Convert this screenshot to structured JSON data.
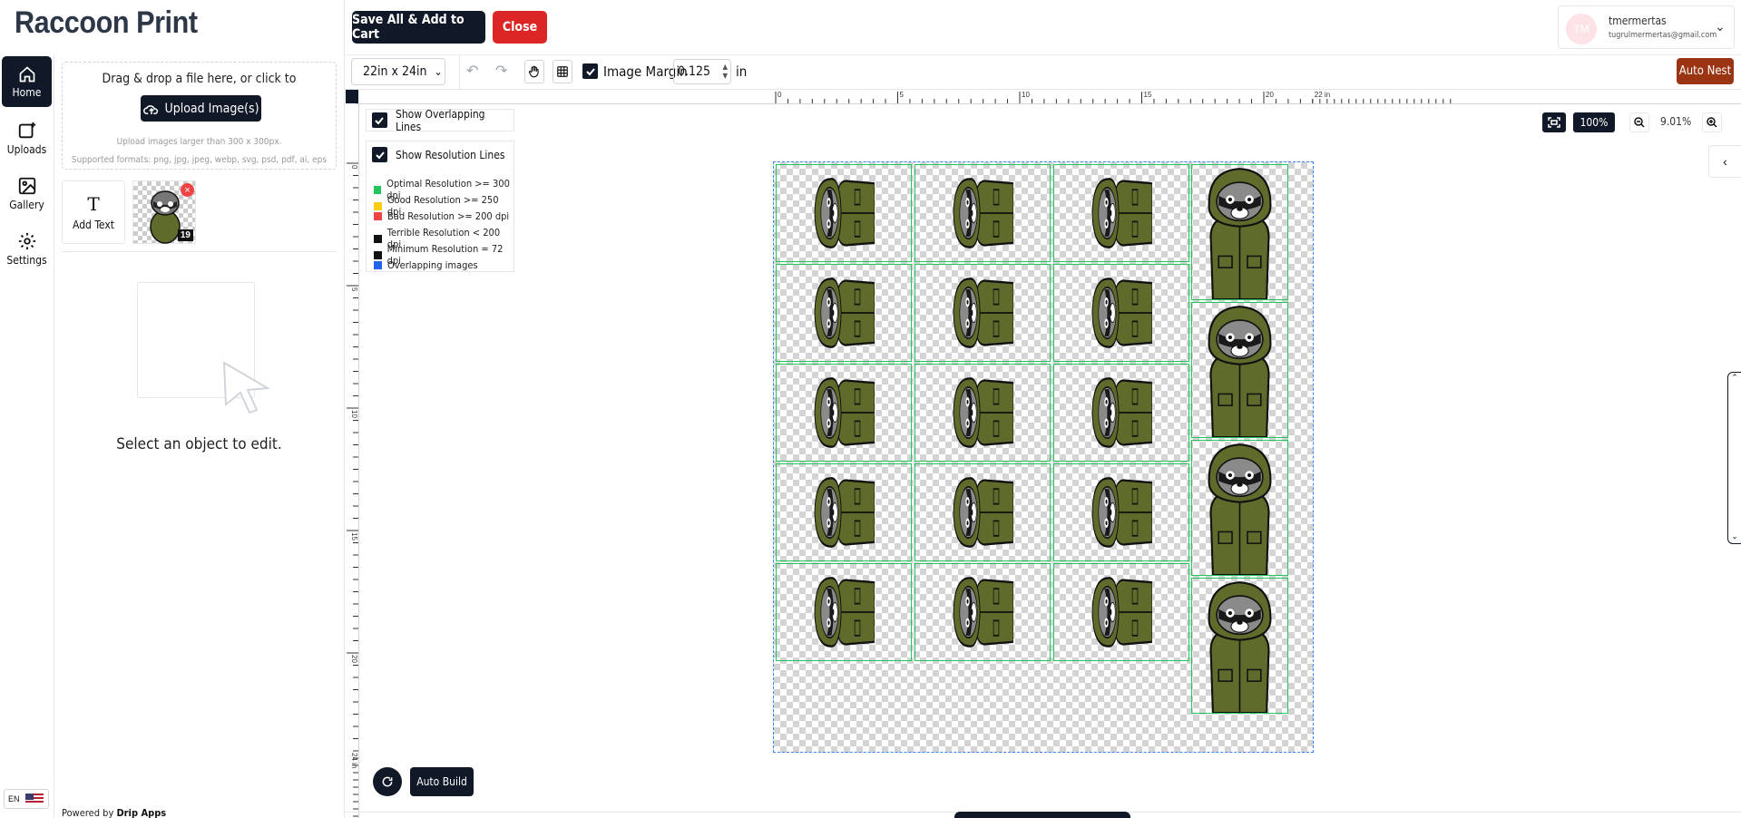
{
  "app": {
    "title": "Raccoon Print"
  },
  "header": {
    "save_label": "Save All & Add to Cart",
    "close_label": "Close"
  },
  "user": {
    "initials": "TM",
    "name": "tmermertas",
    "email": "tugrulmermertas@gmail.com"
  },
  "rail": {
    "items": [
      {
        "label": "Home",
        "icon": "home-icon",
        "active": true
      },
      {
        "label": "Uploads",
        "icon": "uploads-icon"
      },
      {
        "label": "Gallery",
        "icon": "gallery-icon"
      },
      {
        "label": "Settings",
        "icon": "gear-icon"
      }
    ],
    "lang": "EN"
  },
  "panel": {
    "drop_text": "Drag & drop a file here, or click to",
    "upload_label": "Upload Image(s)",
    "hint_line1": "Upload images larger than 300 x 300px.",
    "hint_line2": "Supported formats: png, jpg, jpeg, webp, svg, psd, pdf, ai, eps",
    "add_text_label": "Add Text",
    "thumb_count": "19",
    "select_msg": "Select an object to edit.",
    "powered_prefix": "Powered by",
    "powered_brand": "Drip Apps"
  },
  "toolbar": {
    "size": "22in x 24in",
    "margin_label": "Image Margin",
    "margin_value": "0.125",
    "margin_unit": "in",
    "auto_nest": "Auto Nest"
  },
  "ruler": {
    "top_labels": [
      "0",
      "5",
      "10",
      "15",
      "20",
      "22 in"
    ],
    "left_labels": [
      "0",
      "5",
      "10",
      "15",
      "20",
      "24 in"
    ]
  },
  "overlays": {
    "show_overlapping": "Show Overlapping Lines",
    "show_resolution": "Show Resolution Lines",
    "legend": [
      {
        "label": "Optimal Resolution >= 300 dpi",
        "color": "#22c55e"
      },
      {
        "label": "Good Resolution >= 250 dpi",
        "color": "#facc15"
      },
      {
        "label": "Bad Resolution >= 200 dpi",
        "color": "#ef4444"
      },
      {
        "label": "Terrible Resolution < 200 dpi",
        "color": "#111111"
      },
      {
        "label": "Minimum Resolution = 72 dpi",
        "color": "#111111"
      },
      {
        "label": "Overlapping images",
        "color": "#2563eb"
      }
    ]
  },
  "zoom": {
    "fit_label": "100%",
    "percent": "9.01%"
  },
  "footer": {
    "auto_build": "Auto Build"
  },
  "colors": {
    "primary": "#111827",
    "danger": "#dc2626",
    "nest": "#9a3412",
    "tile_border": "#22c55e",
    "jacket": "#5f6b2a"
  },
  "canvas": {
    "sideways_tiles": 15,
    "upright_tiles": 4
  }
}
